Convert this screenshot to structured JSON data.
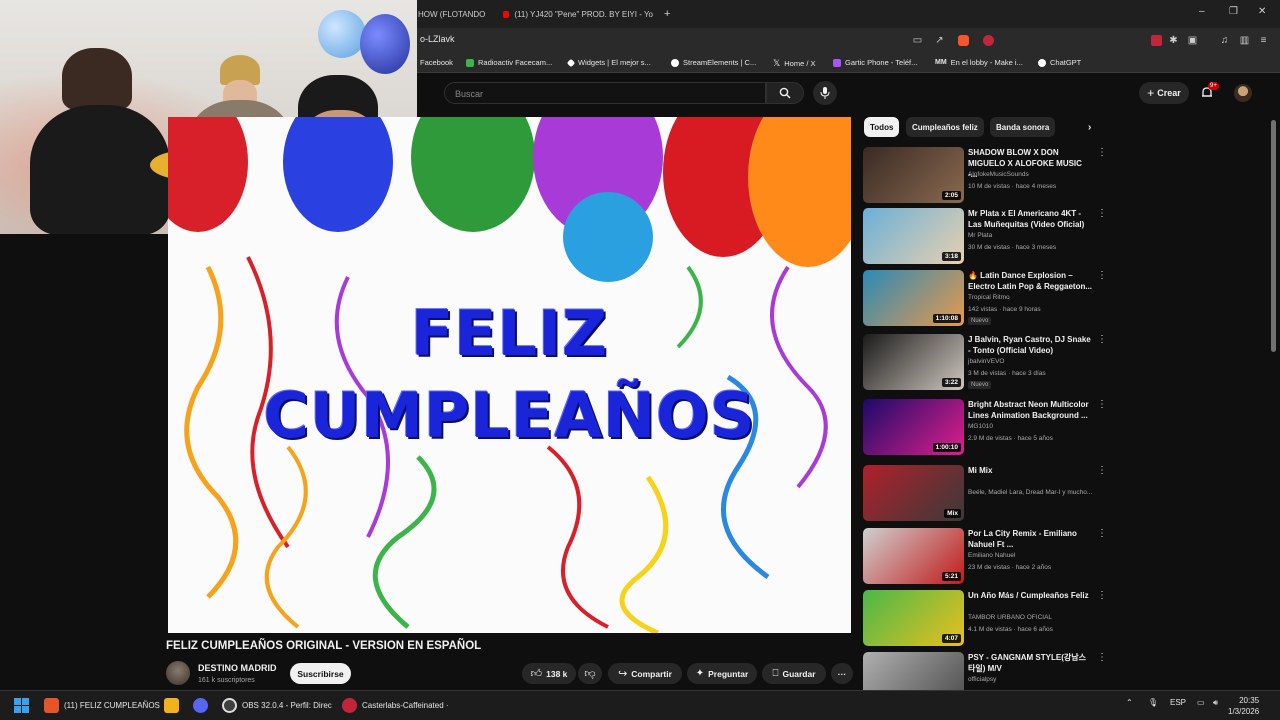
{
  "browser": {
    "tabs": [
      {
        "label": "HOW (FLOTANDO"
      },
      {
        "label": "(11) YJ420 \"Pene\" PROD. BY EIYI - Yo"
      }
    ],
    "new_tab": "+",
    "window_controls": {
      "minimize": "–",
      "maximize": "❐",
      "close": "✕"
    },
    "url": "o-LZlavk",
    "bookmarks": [
      {
        "label": "Facebook",
        "color": "#1877f2"
      },
      {
        "label": "Radioactiv Facecam...",
        "color": "#3bb54a"
      },
      {
        "label": "Widgets | El mejor s...",
        "color": "#ffffff"
      },
      {
        "label": "StreamElements | C...",
        "color": "#ffffff"
      },
      {
        "label": "Home / X",
        "color": "#ffffff"
      },
      {
        "label": "Gartic Phone - Teléf...",
        "color": "#a855f7"
      },
      {
        "label": "En el lobby - Make i...",
        "color": "#ffffff"
      },
      {
        "label": "ChatGPT",
        "color": "#ffffff"
      }
    ]
  },
  "youtube": {
    "search_placeholder": "Buscar",
    "create_label": "Crear",
    "notifications_badge": "9+",
    "video": {
      "line1": "FELIZ",
      "line2": "CUMPLEAÑOS",
      "title": "FELIZ CUMPLEAÑOS ORIGINAL - VERSION EN ESPAÑOL",
      "channel": "DESTINO MADRID",
      "subscribers": "161 k suscriptores",
      "subscribe_label": "Suscribirse",
      "likes": "138 k",
      "share_label": "Compartir",
      "ask_label": "Preguntar",
      "save_label": "Guardar",
      "more_label": "···"
    },
    "chips": [
      "Todos",
      "Cumpleaños feliz",
      "Banda sonora"
    ],
    "recommendations": [
      {
        "title": "SHADOW BLOW X DON MIGUELO X ALOFOKE MUSIC -...",
        "channel": "AlofokeMusicSounds",
        "meta": "10 M de vistas · hace 4 meses",
        "duration": "2:05",
        "badge": "",
        "c1": "#3a2a24",
        "c2": "#8a6a50"
      },
      {
        "title": "Mr Plata x El Americano 4KT - Las Muñequitas (Video Oficial)",
        "channel": "Mr Plata",
        "meta": "30 M de vistas · hace 3 meses",
        "duration": "3:18",
        "badge": "",
        "c1": "#6ab0d8",
        "c2": "#e8d0b0"
      },
      {
        "title": "🔥 Latin Dance Explosion – Electro Latin Pop & Reggaeton...",
        "channel": "Tropical Ritmo",
        "meta": "142 vistas · hace 9 horas",
        "duration": "1:10:08",
        "badge": "Nuevo",
        "c1": "#2a8ab8",
        "c2": "#e89a4a"
      },
      {
        "title": "J Balvin, Ryan Castro, DJ Snake - Tonto (Official Video)",
        "channel": "jbalvinVEVO",
        "meta": "3 M de vistas · hace 3 días",
        "duration": "3:22",
        "badge": "Nuevo",
        "c1": "#1a1a1a",
        "c2": "#d0c8c0"
      },
      {
        "title": "Bright Abstract Neon Multicolor Lines Animation Background ...",
        "channel": "MG1010",
        "meta": "2.9 M de vistas · hace 5 años",
        "duration": "1:00:10",
        "badge": "",
        "c1": "#1a0a6a",
        "c2": "#e0208a"
      },
      {
        "title": "Mi Mix",
        "channel": "Beéle, Madiel Lara, Dread Mar-I y mucho...",
        "meta": "",
        "duration": "Mix",
        "badge": "",
        "c1": "#b0202a",
        "c2": "#3a3a3a"
      },
      {
        "title": "Por La City Remix - Emiliano Nahuel Ft ...",
        "channel": "Emiliano Nahuel",
        "meta": "23 M de vistas · hace 2 años",
        "duration": "5:21",
        "badge": "",
        "c1": "#d0d0d0",
        "c2": "#c01a1a"
      },
      {
        "title": "Un Año Más / Cumpleaños Feliz",
        "channel": "TAMBOR URBANO OFICIAL",
        "meta": "4.1 M de vistas · hace 6 años",
        "duration": "4:07",
        "badge": "",
        "c1": "#4ab84a",
        "c2": "#e8c020"
      },
      {
        "title": "PSY - GANGNAM STYLE(강남스타일) M/V",
        "channel": "officialpsy",
        "meta": "",
        "duration": "",
        "badge": "",
        "c1": "#b0b0b0",
        "c2": "#4a4a4a"
      }
    ]
  },
  "taskbar": {
    "items": [
      {
        "label": "(11) FELIZ CUMPLEAÑOS",
        "color": "#e8542a"
      },
      {
        "label": "",
        "color": "#f2b21b"
      },
      {
        "label": "",
        "color": "#5865f2"
      },
      {
        "label": "OBS 32.0.4 - Perfil: Direc",
        "color": "#404040"
      },
      {
        "label": "Casterlabs-Caffeinated ·",
        "color": "#c2243a"
      }
    ],
    "lang": "ESP",
    "time": "20:35",
    "date": "1/3/2026"
  }
}
